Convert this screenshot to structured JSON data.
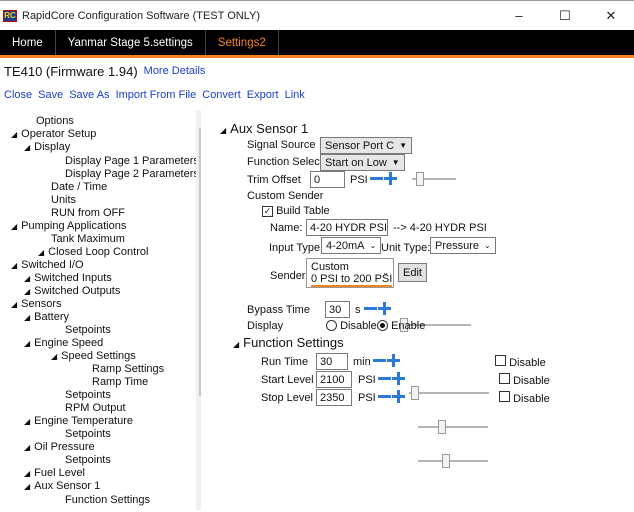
{
  "window": {
    "title": "RapidCore Configuration Software (TEST ONLY)",
    "icon_text": "RC",
    "minimize": "–",
    "maximize": "☐",
    "close": "✕"
  },
  "tabs": [
    "Home",
    "Yanmar Stage 5.settings",
    "Settings2"
  ],
  "firmware": {
    "label": "TE410 (Firmware 1.94)",
    "more": "More Details"
  },
  "menu": [
    "Close",
    "Save",
    "Save As",
    "Import From File",
    "Convert",
    "Export",
    "Link"
  ],
  "tree": [
    {
      "label": "Options"
    },
    {
      "label": "Operator Setup"
    },
    {
      "label": "Display"
    },
    {
      "label": "Display Page 1 Parameters"
    },
    {
      "label": "Display Page 2 Parameters"
    },
    {
      "label": "Date / Time"
    },
    {
      "label": "Units"
    },
    {
      "label": "RUN from OFF"
    },
    {
      "label": "Pumping Applications"
    },
    {
      "label": "Tank Maximum"
    },
    {
      "label": "Closed Loop Control"
    },
    {
      "label": "Switched I/O"
    },
    {
      "label": "Switched Inputs"
    },
    {
      "label": "Switched Outputs"
    },
    {
      "label": "Sensors"
    },
    {
      "label": "Battery"
    },
    {
      "label": "Setpoints"
    },
    {
      "label": "Engine Speed"
    },
    {
      "label": "Speed Settings"
    },
    {
      "label": "Ramp Settings"
    },
    {
      "label": "Ramp Time"
    },
    {
      "label": "Setpoints"
    },
    {
      "label": "RPM Output"
    },
    {
      "label": "Engine Temperature"
    },
    {
      "label": "Setpoints"
    },
    {
      "label": "Oil Pressure"
    },
    {
      "label": "Setpoints"
    },
    {
      "label": "Fuel Level"
    },
    {
      "label": "Aux Sensor 1"
    },
    {
      "label": "Function Settings"
    }
  ],
  "aux": {
    "header": "Aux Sensor 1",
    "signal_source_label": "Signal Source",
    "signal_source_value": "Sensor Port C",
    "function_select_label": "Function Select",
    "function_select_value": "Start on Low",
    "trim_offset_label": "Trim Offset",
    "trim_offset_value": "0",
    "trim_offset_unit": "PSI",
    "custom_sender_label": "Custom Sender",
    "build_table_label": "Build Table",
    "name_label": "Name:",
    "name_value": "4-20 HYDR PSI",
    "name_result": "--> 4-20 HYDR PSI",
    "input_type_label": "Input Type:",
    "input_type_value": "4-20mA",
    "unit_type_label": "Unit Type:",
    "unit_type_value": "Pressure",
    "sender_label": "Sender:",
    "sender_line1": "Custom",
    "sender_line2": "0 PSI to 200 PSI",
    "edit_label": "Edit",
    "bypass_label": "Bypass Time",
    "bypass_value": "30",
    "bypass_unit": "s",
    "display_label": "Display",
    "disable_label": "Disable",
    "enable_label": "Enable"
  },
  "function_settings": {
    "header": "Function Settings",
    "rows": [
      {
        "label": "Run Time",
        "value": "30",
        "unit": "min",
        "disable": "Disable"
      },
      {
        "label": "Start Level",
        "value": "2100",
        "unit": "PSI",
        "disable": "Disable"
      },
      {
        "label": "Stop Level",
        "value": "2350",
        "unit": "PSI",
        "disable": "Disable"
      }
    ]
  },
  "colors": {
    "accent": "#f58220",
    "link": "#1a40c8",
    "spin": "#2d7ad6"
  }
}
